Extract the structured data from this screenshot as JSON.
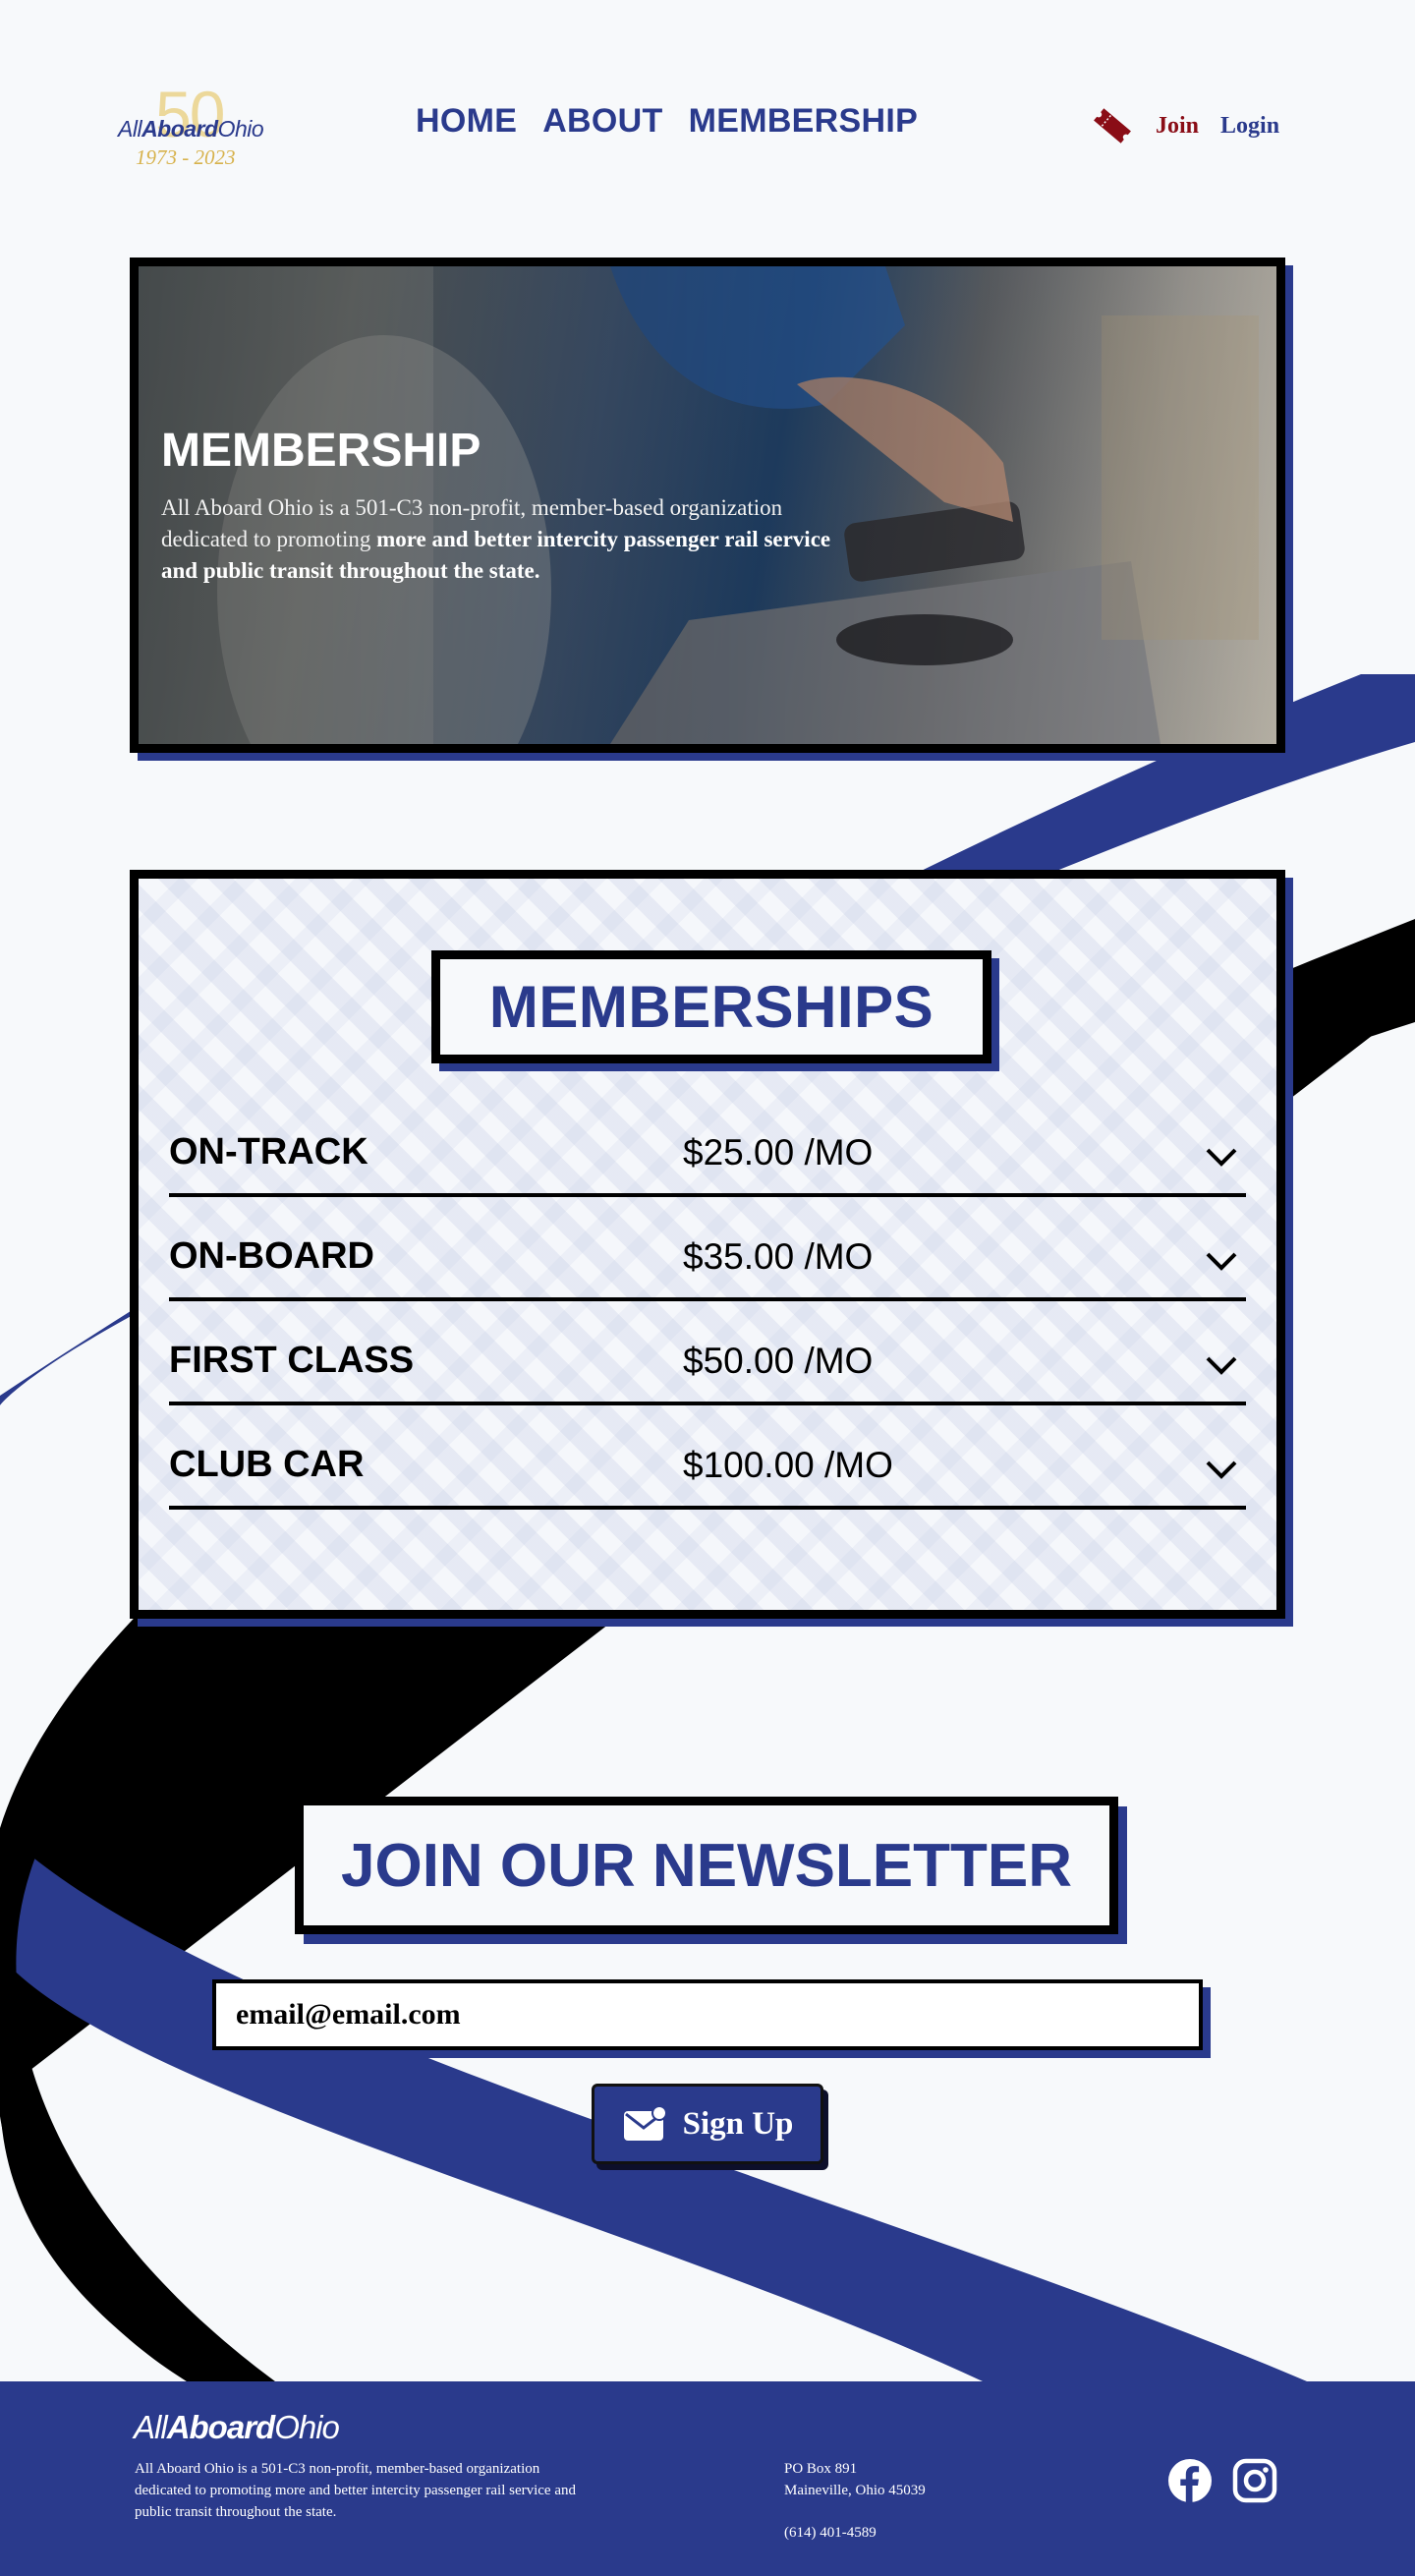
{
  "header": {
    "logo": {
      "number": "50",
      "word_light": "All",
      "word_bold": "Aboard",
      "word_end": "Ohio",
      "years": "1973 - 2023"
    },
    "nav": [
      {
        "label": "HOME"
      },
      {
        "label": "ABOUT"
      },
      {
        "label": "MEMBERSHIP"
      }
    ],
    "join_label": "Join",
    "login_label": "Login",
    "ticket_icon": "ticket-icon"
  },
  "hero": {
    "title": "MEMBERSHIP",
    "text_plain": "All Aboard Ohio is a 501-C3 non-profit, member-based organization dedicated to promoting ",
    "text_bold": "more and better intercity passenger rail service and public transit throughout the state."
  },
  "memberships": {
    "title": "MEMBERSHIPS",
    "tiers": [
      {
        "name": "ON-TRACK",
        "price": "$25.00 /MO"
      },
      {
        "name": "ON-BOARD",
        "price": "$35.00 /MO"
      },
      {
        "name": "FIRST CLASS",
        "price": "$50.00 /MO"
      },
      {
        "name": "CLUB CAR",
        "price": "$100.00 /MO"
      }
    ]
  },
  "newsletter": {
    "title": "JOIN OUR NEWSLETTER",
    "email_placeholder": "email@email.com",
    "signup_label": "Sign Up"
  },
  "footer": {
    "logo_light": "All",
    "logo_bold": "Aboard",
    "logo_end": "Ohio",
    "description": "All Aboard Ohio is a 501-C3 non-profit, member-based organization dedicated to promoting more and better intercity passenger rail service and public transit throughout the state.",
    "address_line1": "PO Box 891",
    "address_line2": "Maineville, Ohio 45039",
    "phone": "(614) 401-4589",
    "social_icons": [
      "facebook-icon",
      "instagram-icon"
    ]
  },
  "colors": {
    "brand_blue": "#2a3a8c",
    "accent_red": "#8a0d16",
    "gold": "#d7b24c",
    "background": "#f7f9fb"
  }
}
